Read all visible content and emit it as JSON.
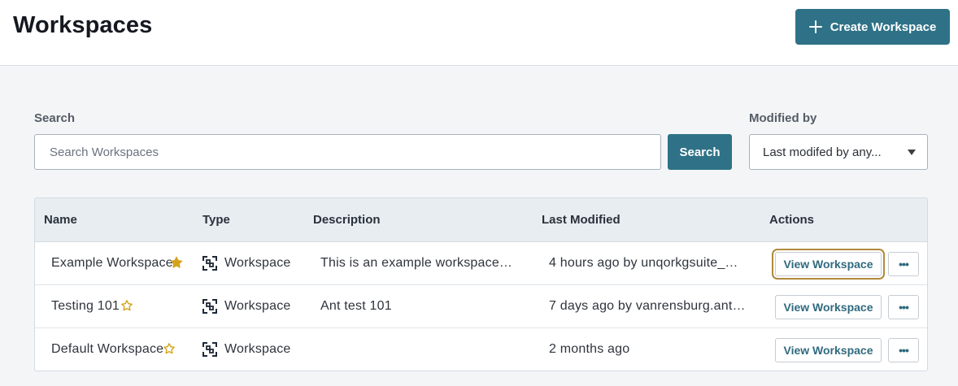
{
  "header": {
    "title": "Workspaces",
    "create_label": "Create Workspace"
  },
  "search": {
    "label": "Search",
    "placeholder": "Search Workspaces",
    "value": "",
    "button_label": "Search"
  },
  "filter": {
    "label": "Modified by",
    "selected": "Last modifed by any..."
  },
  "table": {
    "columns": [
      "Name",
      "Type",
      "Description",
      "Last Modified",
      "Actions"
    ],
    "rows": [
      {
        "name": "Example Workspace",
        "starred": true,
        "type": "Workspace",
        "description": "This is an example workspace co...",
        "last_modified": "4 hours ago by unqorkgsuite_mik...",
        "view_label": "View Workspace",
        "more_label": "•••"
      },
      {
        "name": "Testing 101",
        "starred": false,
        "type": "Workspace",
        "description": "Ant test 101",
        "last_modified": "7 days ago by vanrensburg.anth...",
        "view_label": "View Workspace",
        "more_label": "•••"
      },
      {
        "name": "Default Workspace",
        "starred": false,
        "type": "Workspace",
        "description": "",
        "last_modified": "2 months ago",
        "view_label": "View Workspace",
        "more_label": "•••"
      }
    ]
  },
  "colors": {
    "primary": "#2f7287",
    "star": "#d4a21a",
    "focus_ring": "#b08a3a"
  },
  "icons": {
    "create": "plus-icon",
    "select": "caret-down-icon",
    "star_filled": "star-filled-icon",
    "star_outline": "star-outline-icon",
    "type": "workspace-icon",
    "more": "more-horizontal-icon"
  }
}
